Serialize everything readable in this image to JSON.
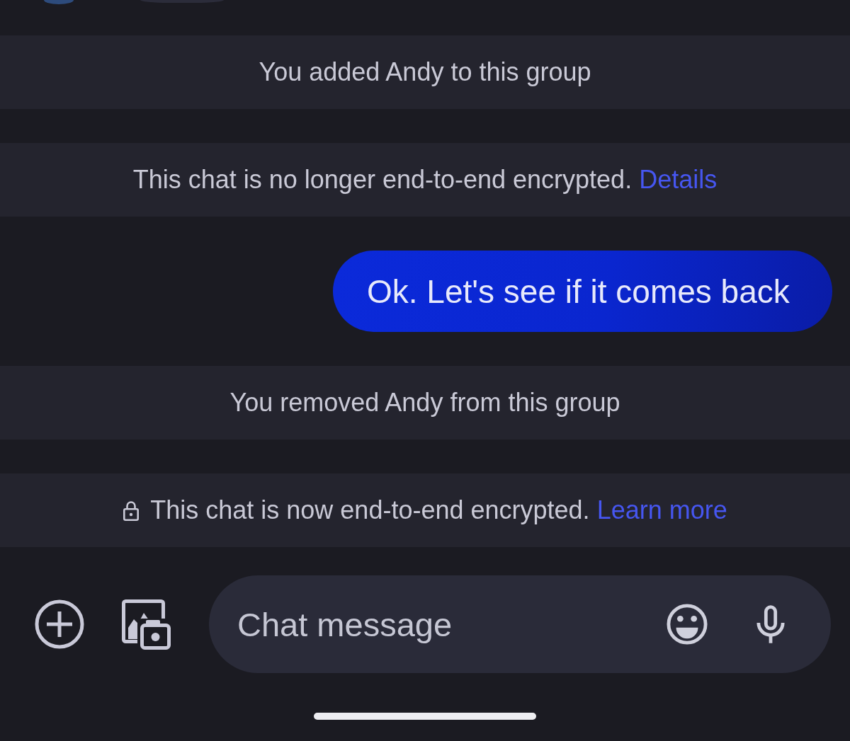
{
  "messages": [
    {
      "kind": "notice",
      "text": "You added Andy to this group"
    },
    {
      "kind": "notice",
      "text": "This chat is no longer end-to-end encrypted.",
      "link": "Details"
    },
    {
      "kind": "outgoing",
      "text": "Ok. Let's see if it comes back"
    },
    {
      "kind": "notice",
      "text": "You removed Andy from this group"
    },
    {
      "kind": "secure_notice",
      "text": "This chat is now end-to-end encrypted.",
      "link": "Learn more"
    }
  ],
  "composer": {
    "placeholder": "Chat message"
  }
}
